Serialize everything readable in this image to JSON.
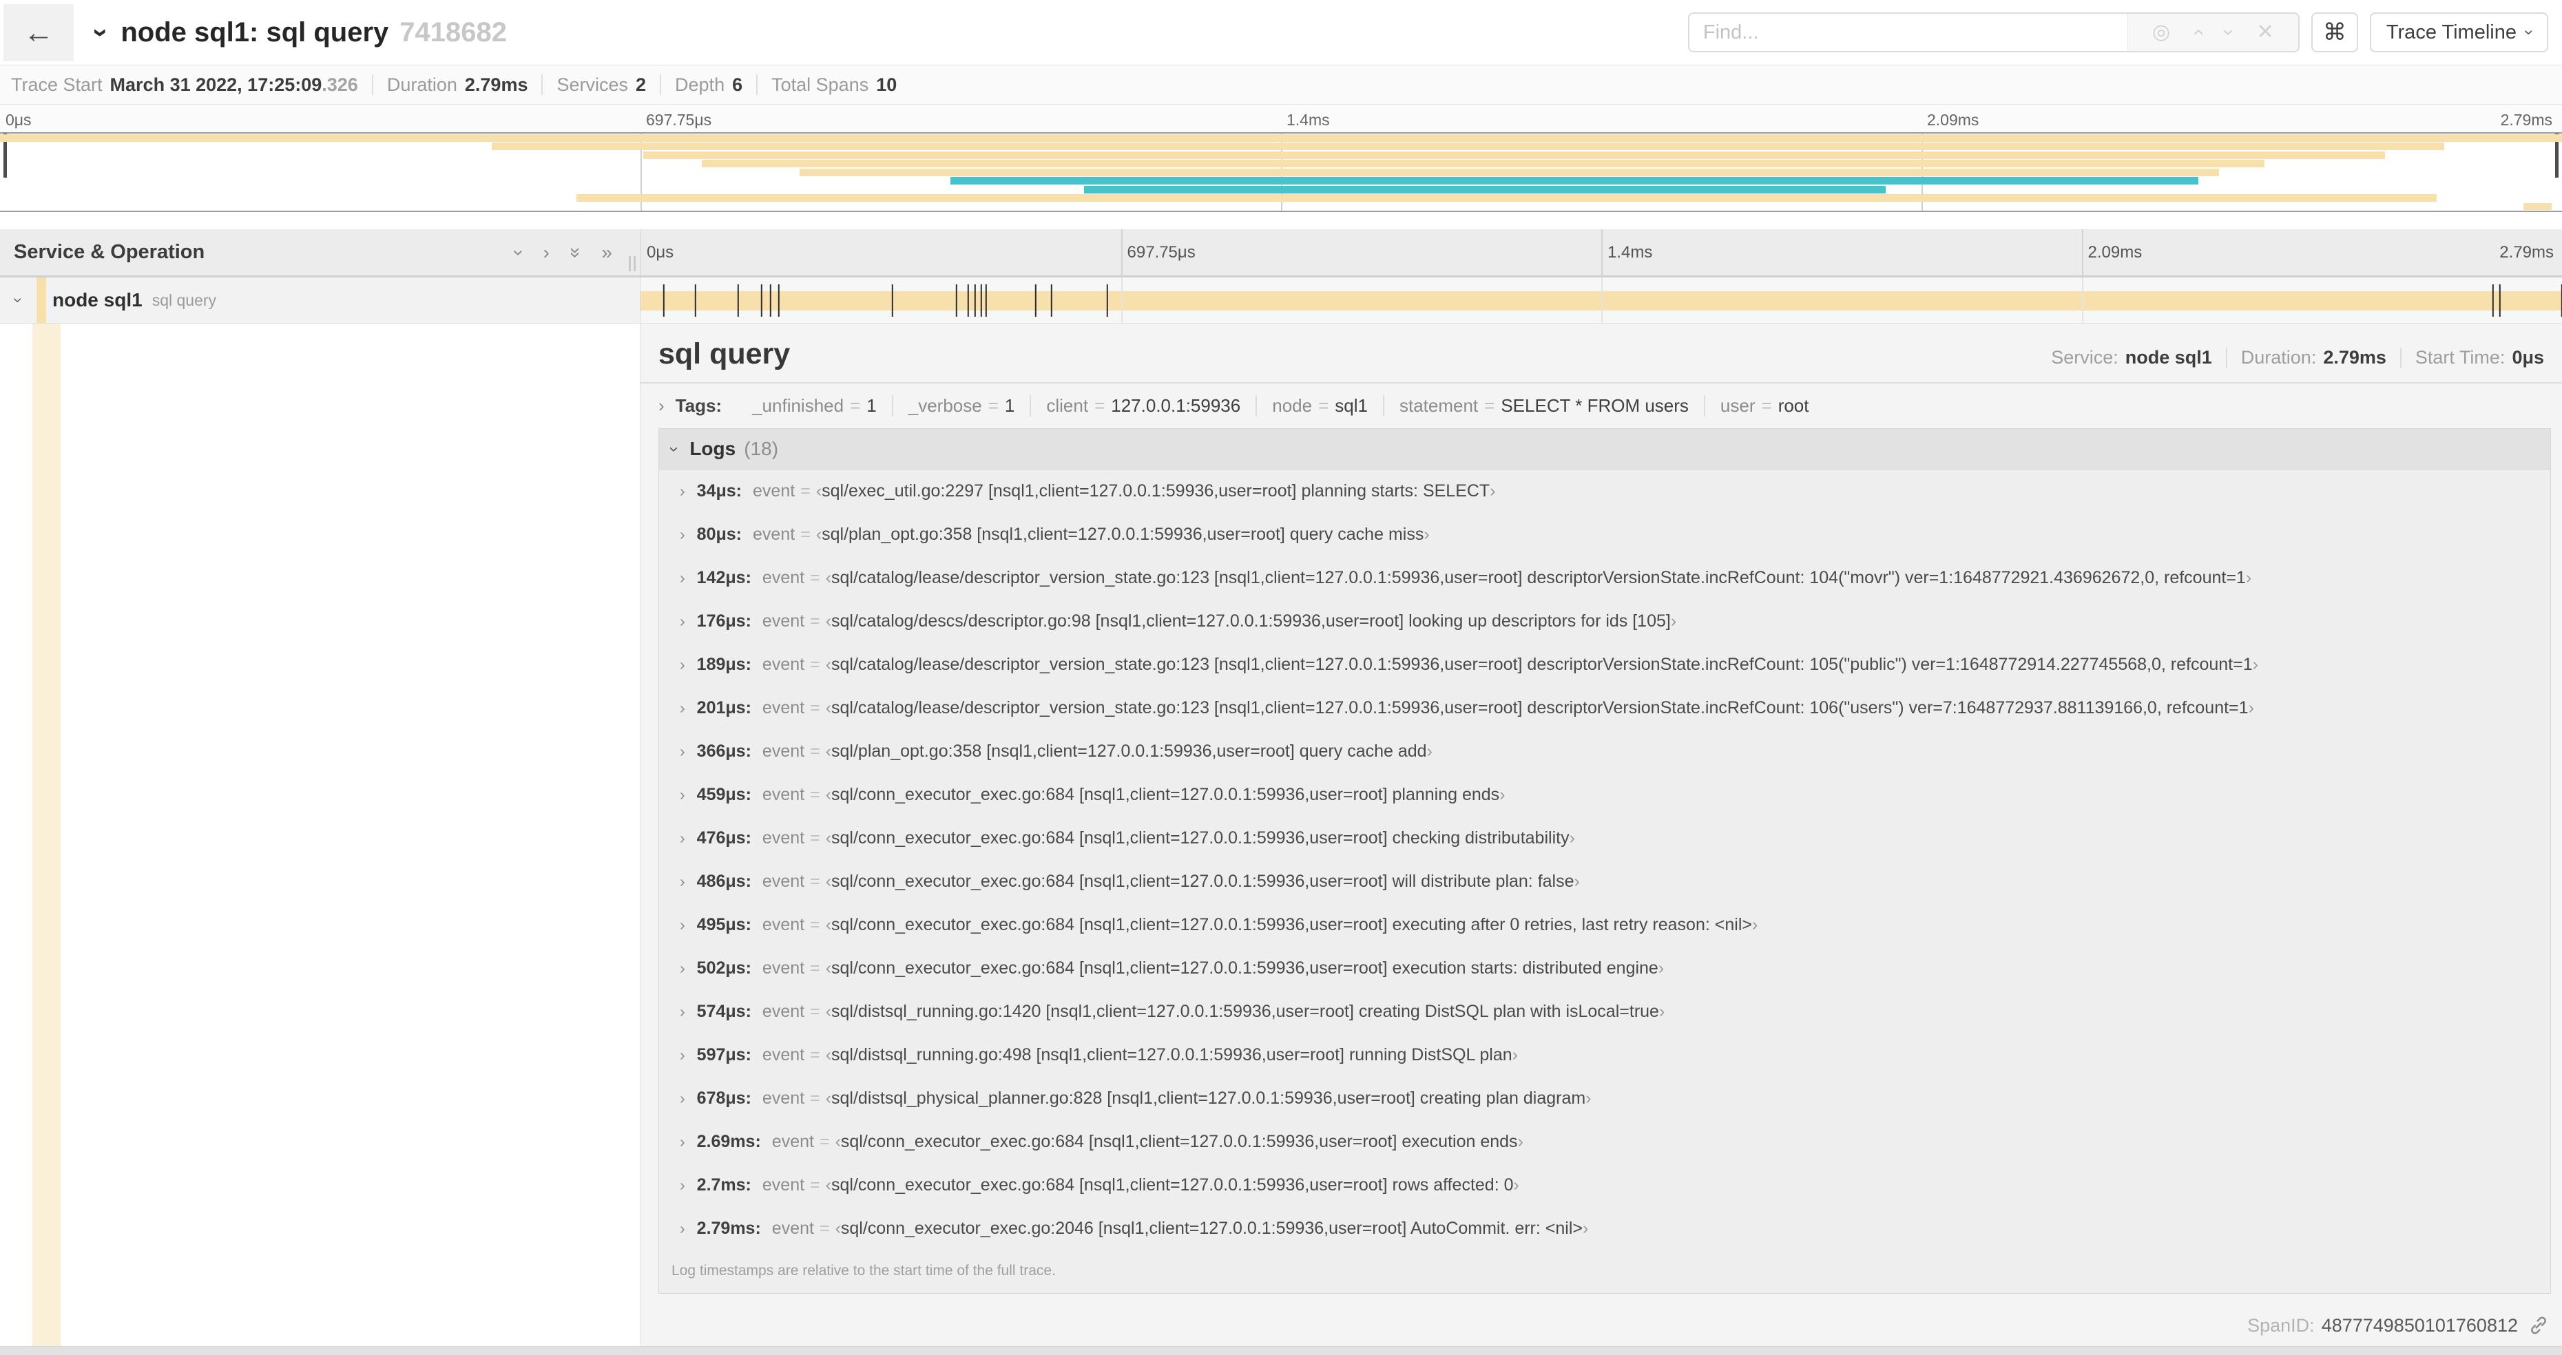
{
  "header": {
    "back": "←",
    "title": "node sql1: sql query",
    "trace_id_short": "7418682",
    "find_placeholder": "Find...",
    "shortcut_key": "⌘",
    "view_selector": "Trace Timeline"
  },
  "summary": {
    "items": [
      {
        "label": "Trace Start",
        "value": "March 31 2022, 17:25:09",
        "suffix": ".326"
      },
      {
        "label": "Duration",
        "value": "2.79ms"
      },
      {
        "label": "Services",
        "value": "2"
      },
      {
        "label": "Depth",
        "value": "6"
      },
      {
        "label": "Total Spans",
        "value": "10"
      }
    ]
  },
  "colors": {
    "tan": "#F8E0AC",
    "tan_pale": "#FAF0D8",
    "teal": "#45C5CB"
  },
  "minimap": {
    "ticks": [
      {
        "label": "0μs",
        "pct": 0
      },
      {
        "label": "697.75μs",
        "pct": 25
      },
      {
        "label": "1.4ms",
        "pct": 50
      },
      {
        "label": "2.09ms",
        "pct": 75
      },
      {
        "label": "2.79ms",
        "pct": 100
      }
    ],
    "gridlines_pct": [
      25,
      50,
      75
    ],
    "spans": [
      {
        "start": 0.0,
        "end": 1.0,
        "color": "tan"
      },
      {
        "start": 0.192,
        "end": 0.954,
        "color": "tan"
      },
      {
        "start": 0.251,
        "end": 0.931,
        "color": "tan"
      },
      {
        "start": 0.274,
        "end": 0.884,
        "color": "tan"
      },
      {
        "start": 0.312,
        "end": 0.866,
        "color": "tan"
      },
      {
        "start": 0.371,
        "end": 0.858,
        "color": "teal"
      },
      {
        "start": 0.423,
        "end": 0.736,
        "color": "teal"
      },
      {
        "start": 0.225,
        "end": 0.951,
        "color": "tan"
      },
      {
        "start": 0.985,
        "end": 0.996,
        "color": "tan"
      }
    ]
  },
  "timeline": {
    "column_header": "Service & Operation",
    "row": {
      "service": "node sql1",
      "operation": "sql query"
    },
    "total_duration_us": 2790
  },
  "detail": {
    "title": "sql query",
    "service_label": "Service:",
    "service": "node sql1",
    "duration_label": "Duration:",
    "duration": "2.79ms",
    "start_label": "Start Time:",
    "start": "0μs",
    "tags_label": "Tags:",
    "tags": [
      {
        "key": "_unfinished",
        "value": "1"
      },
      {
        "key": "_verbose",
        "value": "1"
      },
      {
        "key": "client",
        "value": "127.0.0.1:59936"
      },
      {
        "key": "node",
        "value": "sql1"
      },
      {
        "key": "statement",
        "value": "SELECT * FROM users"
      },
      {
        "key": "user",
        "value": "root"
      }
    ],
    "logs_label": "Logs",
    "logs_count": "(18)",
    "log_field_key": "event",
    "logs": [
      {
        "time_label": "34μs",
        "time_us": 34,
        "message": "sql/exec_util.go:2297 [nsql1,client=127.0.0.1:59936,user=root] planning starts: SELECT"
      },
      {
        "time_label": "80μs",
        "time_us": 80,
        "message": "sql/plan_opt.go:358 [nsql1,client=127.0.0.1:59936,user=root] query cache miss"
      },
      {
        "time_label": "142μs",
        "time_us": 142,
        "message": "sql/catalog/lease/descriptor_version_state.go:123 [nsql1,client=127.0.0.1:59936,user=root] descriptorVersionState.incRefCount: 104(\"movr\") ver=1:1648772921.436962672,0, refcount=1"
      },
      {
        "time_label": "176μs",
        "time_us": 176,
        "message": "sql/catalog/descs/descriptor.go:98 [nsql1,client=127.0.0.1:59936,user=root] looking up descriptors for ids [105]"
      },
      {
        "time_label": "189μs",
        "time_us": 189,
        "message": "sql/catalog/lease/descriptor_version_state.go:123 [nsql1,client=127.0.0.1:59936,user=root] descriptorVersionState.incRefCount: 105(\"public\") ver=1:1648772914.227745568,0, refcount=1"
      },
      {
        "time_label": "201μs",
        "time_us": 201,
        "message": "sql/catalog/lease/descriptor_version_state.go:123 [nsql1,client=127.0.0.1:59936,user=root] descriptorVersionState.incRefCount: 106(\"users\") ver=7:1648772937.881139166,0, refcount=1"
      },
      {
        "time_label": "366μs",
        "time_us": 366,
        "message": "sql/plan_opt.go:358 [nsql1,client=127.0.0.1:59936,user=root] query cache add"
      },
      {
        "time_label": "459μs",
        "time_us": 459,
        "message": "sql/conn_executor_exec.go:684 [nsql1,client=127.0.0.1:59936,user=root] planning ends"
      },
      {
        "time_label": "476μs",
        "time_us": 476,
        "message": "sql/conn_executor_exec.go:684 [nsql1,client=127.0.0.1:59936,user=root] checking distributability"
      },
      {
        "time_label": "486μs",
        "time_us": 486,
        "message": "sql/conn_executor_exec.go:684 [nsql1,client=127.0.0.1:59936,user=root] will distribute plan: false"
      },
      {
        "time_label": "495μs",
        "time_us": 495,
        "message": "sql/conn_executor_exec.go:684 [nsql1,client=127.0.0.1:59936,user=root] executing after 0 retries, last retry reason: <nil>"
      },
      {
        "time_label": "502μs",
        "time_us": 502,
        "message": "sql/conn_executor_exec.go:684 [nsql1,client=127.0.0.1:59936,user=root] execution starts: distributed engine"
      },
      {
        "time_label": "574μs",
        "time_us": 574,
        "message": "sql/distsql_running.go:1420 [nsql1,client=127.0.0.1:59936,user=root] creating DistSQL plan with isLocal=true"
      },
      {
        "time_label": "597μs",
        "time_us": 597,
        "message": "sql/distsql_running.go:498 [nsql1,client=127.0.0.1:59936,user=root] running DistSQL plan"
      },
      {
        "time_label": "678μs",
        "time_us": 678,
        "message": "sql/distsql_physical_planner.go:828 [nsql1,client=127.0.0.1:59936,user=root] creating plan diagram"
      },
      {
        "time_label": "2.69ms",
        "time_us": 2690,
        "message": "sql/conn_executor_exec.go:684 [nsql1,client=127.0.0.1:59936,user=root] execution ends"
      },
      {
        "time_label": "2.7ms",
        "time_us": 2700,
        "message": "sql/conn_executor_exec.go:684 [nsql1,client=127.0.0.1:59936,user=root] rows affected: 0"
      },
      {
        "time_label": "2.79ms",
        "time_us": 2790,
        "message": "sql/conn_executor_exec.go:2046 [nsql1,client=127.0.0.1:59936,user=root] AutoCommit. err: <nil>"
      }
    ],
    "logs_note": "Log timestamps are relative to the start time of the full trace.",
    "span_id_label": "SpanID:",
    "span_id": "4877749850101760812"
  }
}
